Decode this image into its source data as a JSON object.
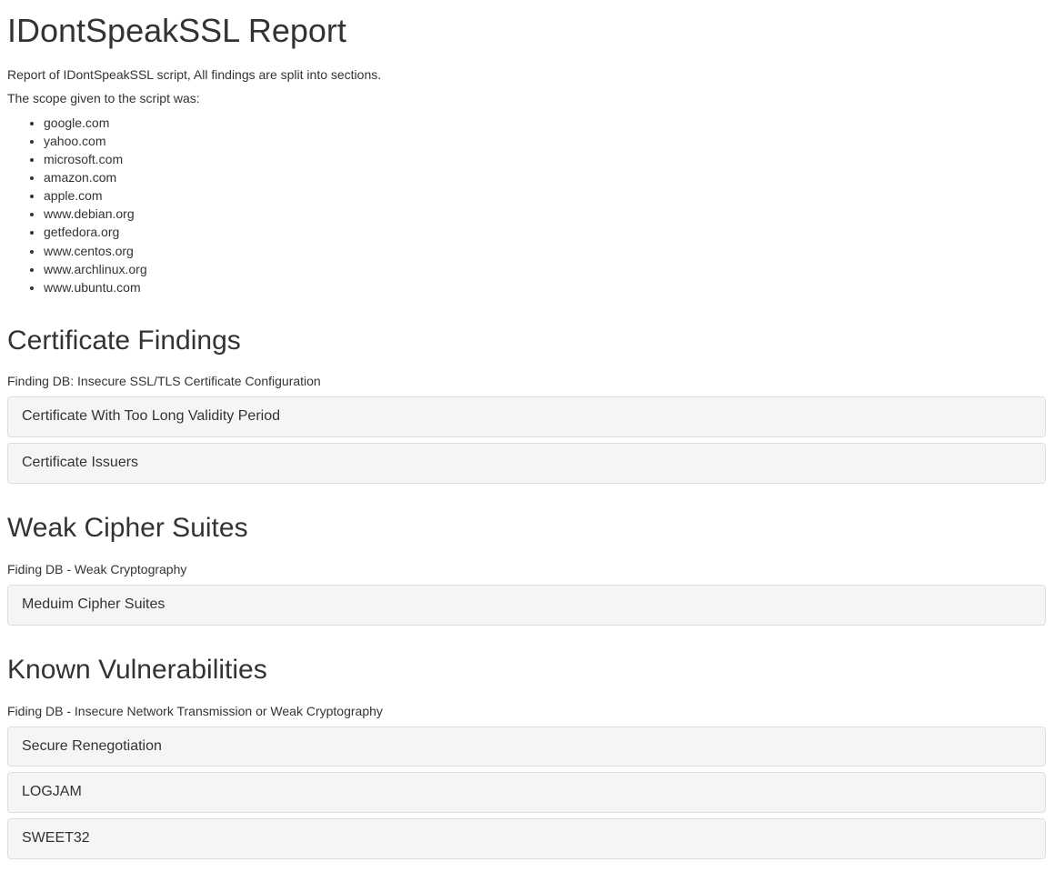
{
  "page": {
    "title": "IDontSpeakSSL Report",
    "intro_line1": "Report of IDontSpeakSSL script, All findings are split into sections.",
    "intro_line2": "The scope given to the script was:",
    "scope_items": [
      "google.com",
      "yahoo.com",
      "microsoft.com",
      "amazon.com",
      "apple.com",
      "www.debian.org",
      "getfedora.org",
      "www.centos.org",
      "www.archlinux.org",
      "www.ubuntu.com"
    ]
  },
  "sections": {
    "certificate_findings": {
      "title": "Certificate Findings",
      "subtitle": "Finding DB: Insecure SSL/TLS Certificate Configuration",
      "panels": [
        "Certificate With Too Long Validity Period",
        "Certificate Issuers"
      ]
    },
    "weak_cipher_suites": {
      "title": "Weak Cipher Suites",
      "subtitle": "Fiding DB - Weak Cryptography",
      "panels": [
        "Meduim Cipher Suites"
      ]
    },
    "known_vulnerabilities": {
      "title": "Known Vulnerabilities",
      "subtitle": "Fiding DB - Insecure Network Transmission or Weak Cryptography",
      "panels": [
        "Secure Renegotiation",
        "LOGJAM",
        "SWEET32"
      ]
    }
  }
}
